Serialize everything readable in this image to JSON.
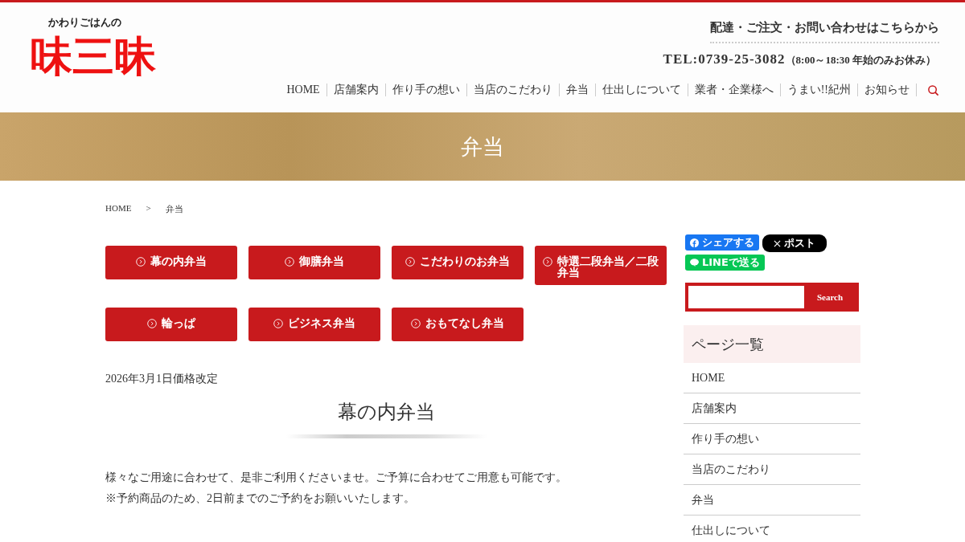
{
  "header": {
    "logo_caption": "かわりごはんの",
    "logo_text": "味三昧",
    "contact_heading": "配達・ご注文・お問い合わせはこちらから",
    "phone": "TEL:0739-25-3082",
    "hours": "（8:00～18:30 年始のみお休み）"
  },
  "nav": [
    "HOME",
    "店舗案内",
    "作り手の想い",
    "当店のこだわり",
    "弁当",
    "仕出しについて",
    "業者・企業様へ",
    "うまい!!紀州",
    "お知らせ"
  ],
  "hero": {
    "title": "弁当"
  },
  "breadcrumb": [
    "HOME",
    "弁当"
  ],
  "breadcrumb_separator": ">",
  "category_buttons": [
    {
      "label": "幕の内弁当"
    },
    {
      "label": "御膳弁当"
    },
    {
      "label": "こだわりのお弁当"
    },
    {
      "label": "特選二段弁当／二段弁当"
    },
    {
      "label": "輪っぱ"
    },
    {
      "label": "ビジネス弁当"
    },
    {
      "label": "おもてなし弁当"
    }
  ],
  "price_note": "2026年3月1日価格改定",
  "section_title": "幕の内弁当",
  "paragraphs": [
    "様々なご用途に合わせて、是非ご利用くださいませ。ご予算に合わせてご用意も可能です。",
    "※予約商品のため、2日前までのご予約をお願いいたします。"
  ],
  "share": {
    "facebook": "シェアする",
    "x": "ポスト",
    "line": "LINEで送る"
  },
  "search": {
    "button": "Search"
  },
  "sidebar": {
    "title": "ページ一覧",
    "items": [
      "HOME",
      "店舗案内",
      "作り手の想い",
      "当店のこだわり",
      "弁当",
      "仕出しについて"
    ]
  }
}
